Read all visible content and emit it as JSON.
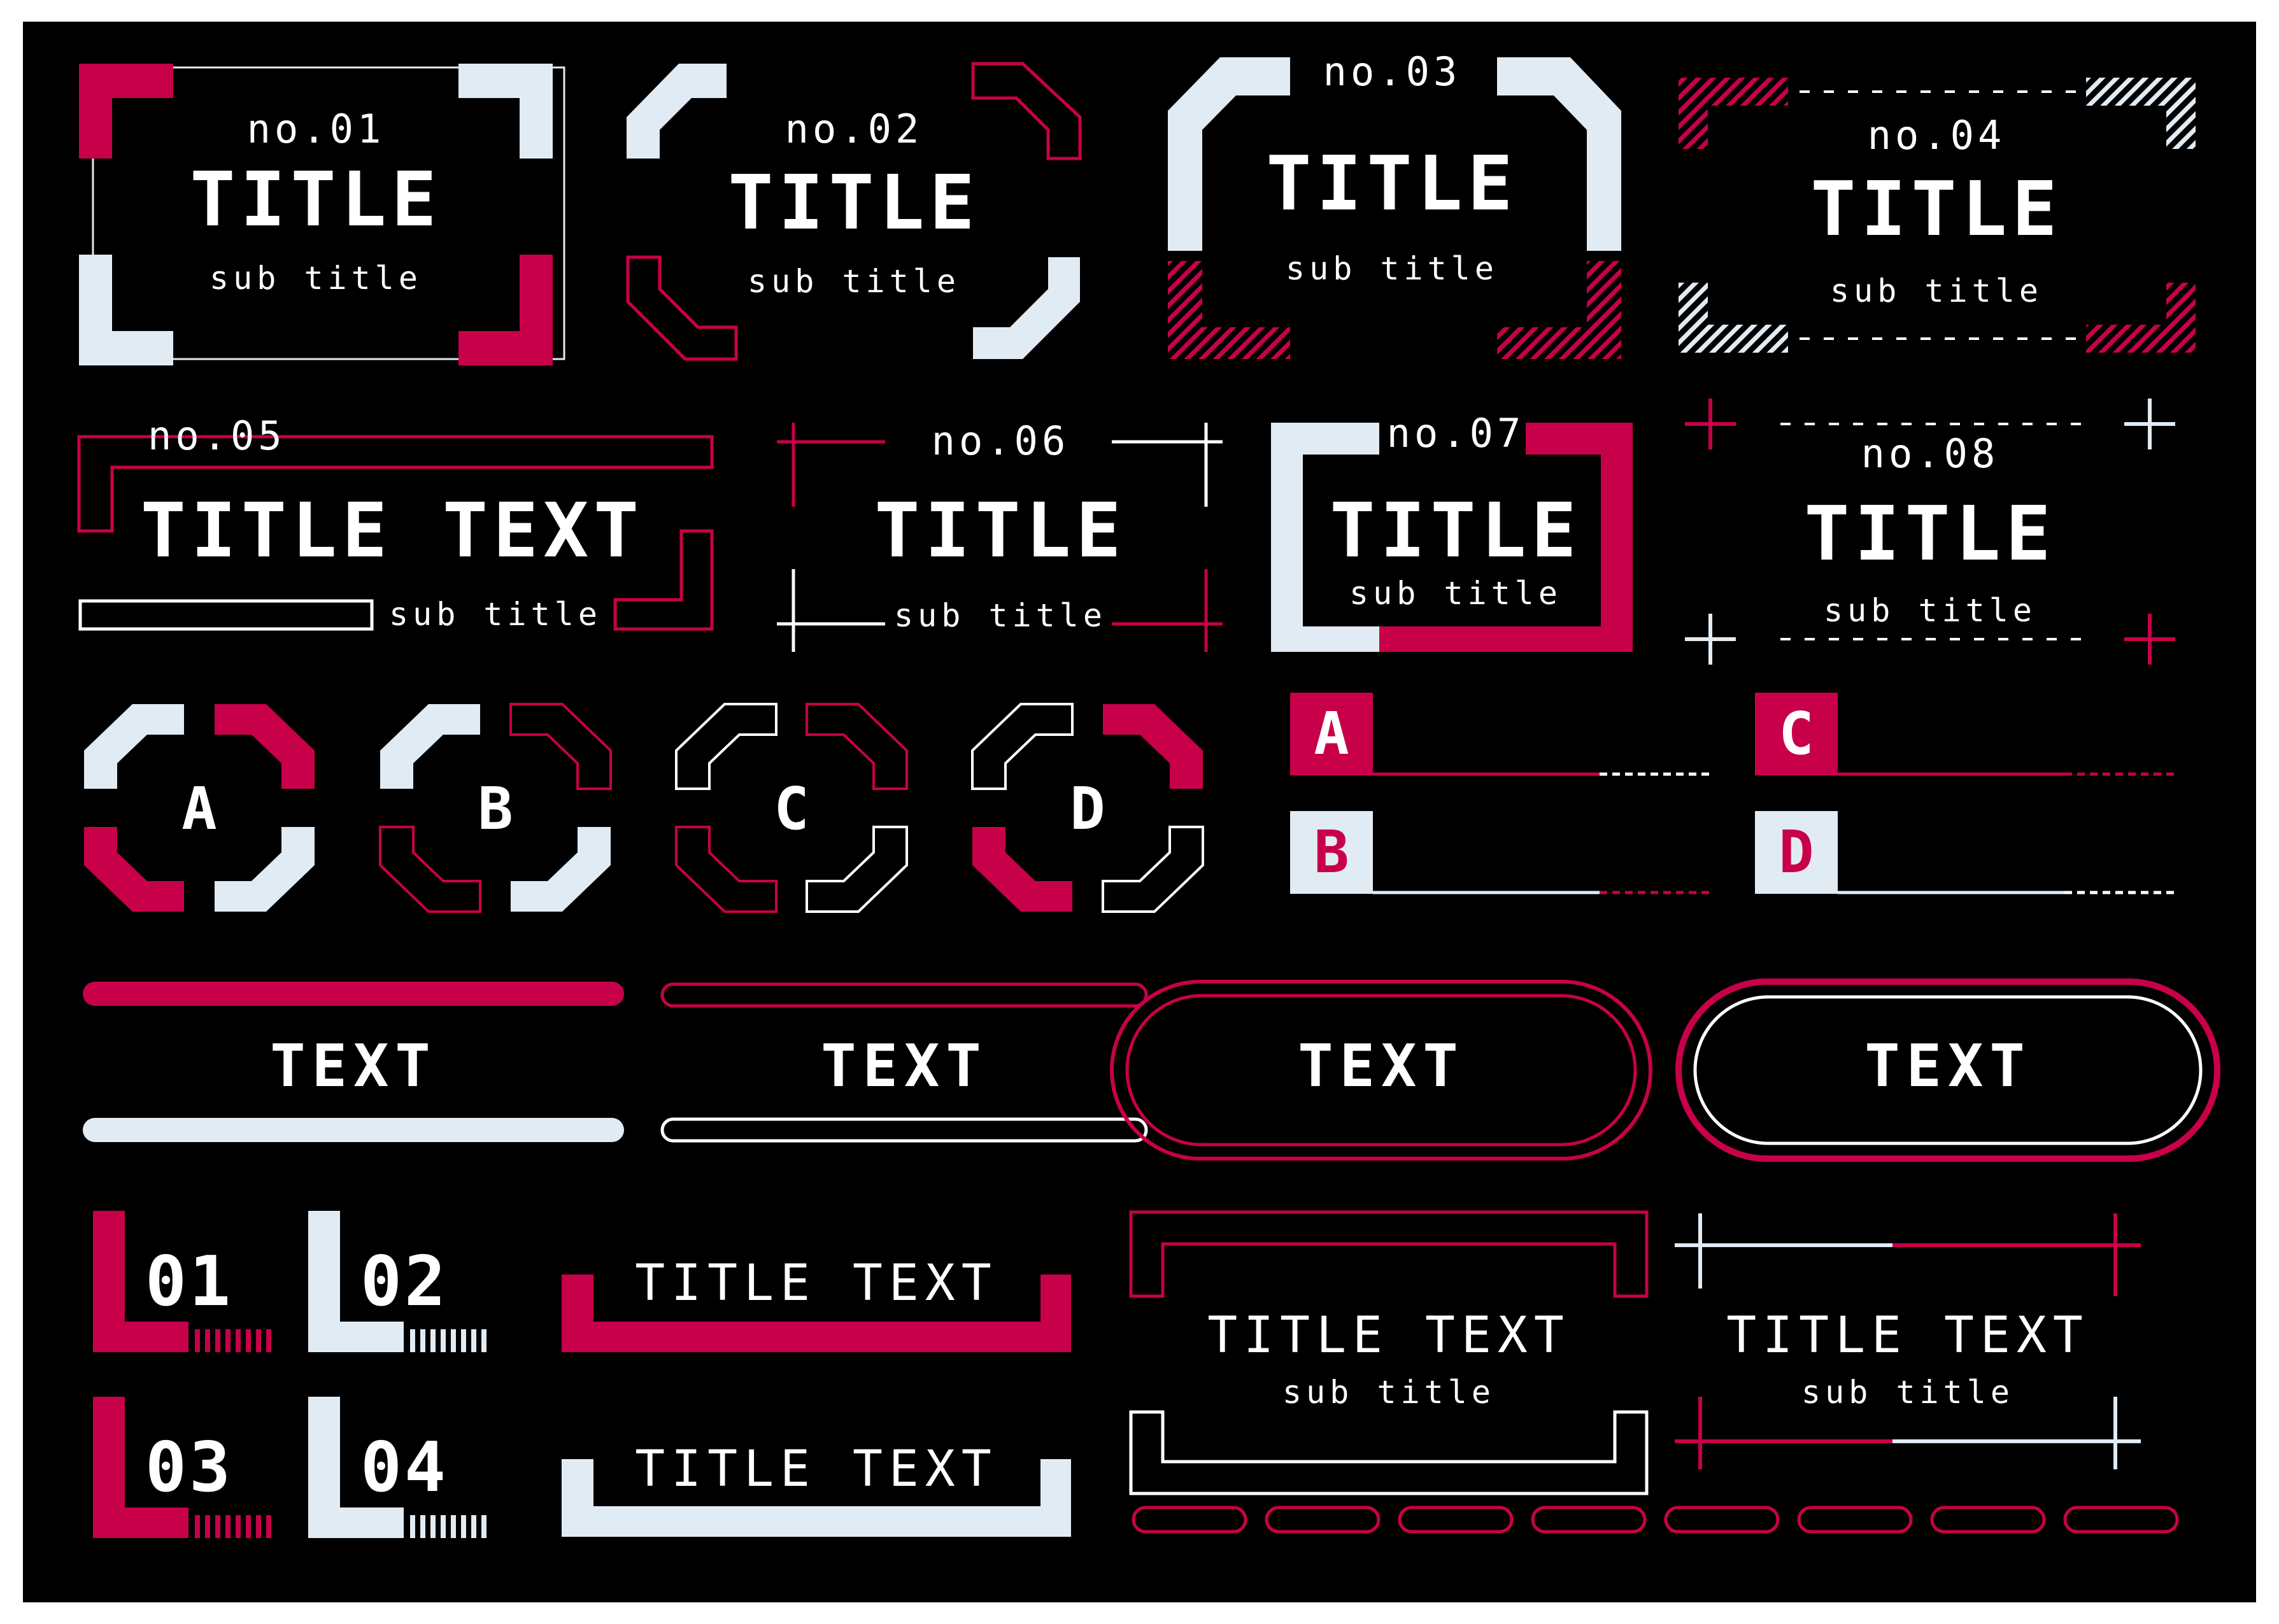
{
  "colors": {
    "background": "#000000",
    "accent": "#C8004A",
    "light": "#E1EBF4",
    "white": "#FFFFFF"
  },
  "frames": {
    "f01": {
      "no": "no.01",
      "title": "TITLE",
      "sub": "sub title"
    },
    "f02": {
      "no": "no.02",
      "title": "TITLE",
      "sub": "sub title"
    },
    "f03": {
      "no": "no.03",
      "title": "TITLE",
      "sub": "sub title"
    },
    "f04": {
      "no": "no.04",
      "title": "TITLE",
      "sub": "sub title"
    },
    "f05": {
      "no": "no.05",
      "title": "TITLE TEXT",
      "sub": "sub title"
    },
    "f06": {
      "no": "no.06",
      "title": "TITLE",
      "sub": "sub title"
    },
    "f07": {
      "no": "no.07",
      "title": "TITLE",
      "sub": "sub title"
    },
    "f08": {
      "no": "no.08",
      "title": "TITLE",
      "sub": "sub title"
    }
  },
  "badges": [
    "A",
    "B",
    "C",
    "D"
  ],
  "tabs": [
    "A",
    "B",
    "C",
    "D"
  ],
  "text_bars": [
    "TEXT",
    "TEXT",
    "TEXT",
    "TEXT"
  ],
  "numbers": [
    "01",
    "02",
    "03",
    "04"
  ],
  "bottom_titles": {
    "bracket_1": "TITLE TEXT",
    "bracket_2": "TITLE TEXT",
    "frame_a": {
      "title": "TITLE TEXT",
      "sub": "sub title"
    },
    "frame_b": {
      "title": "TITLE TEXT",
      "sub": "sub title"
    }
  }
}
